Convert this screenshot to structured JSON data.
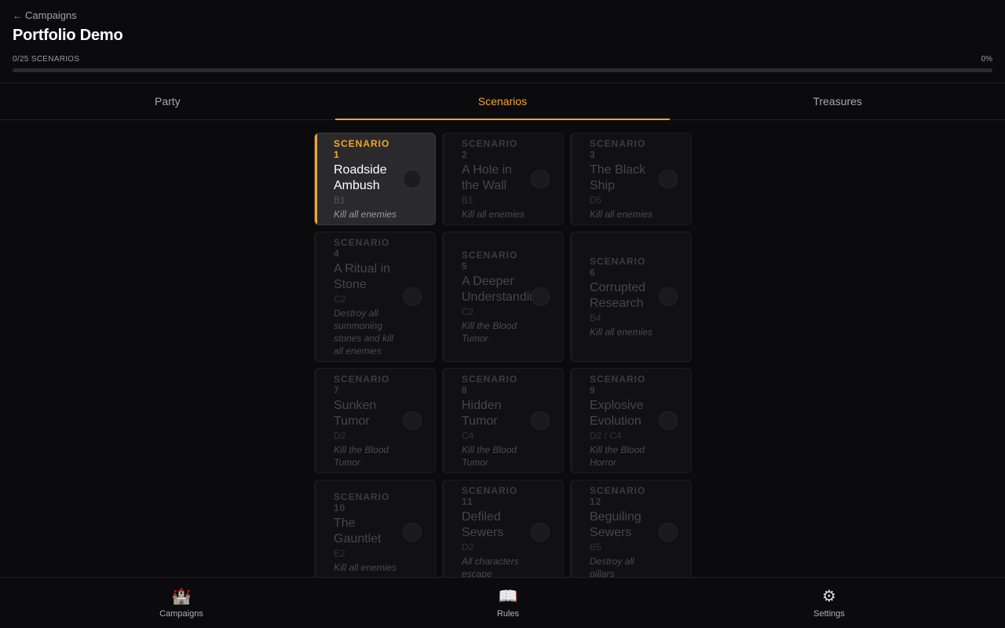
{
  "header": {
    "back_label": "Campaigns",
    "title": "Portfolio Demo",
    "progress_label": "0/25 SCENARIOS",
    "progress_percent_text": "0%",
    "progress_fraction": 0,
    "accent_color": "#f5a623"
  },
  "tabs": [
    {
      "label": "Party",
      "active": false
    },
    {
      "label": "Scenarios",
      "active": true
    },
    {
      "label": "Treasures",
      "active": false
    }
  ],
  "scenarios": [
    {
      "number": "SCENARIO 1",
      "name": "Roadside Ambush",
      "location": "B1",
      "goal": "Kill all enemies",
      "selected": true,
      "completed": false
    },
    {
      "number": "SCENARIO 2",
      "name": "A Hole in the Wall",
      "location": "B1",
      "goal": "Kill all enemies",
      "selected": false,
      "completed": false
    },
    {
      "number": "SCENARIO 3",
      "name": "The Black Ship",
      "location": "D5",
      "goal": "Kill all enemies",
      "selected": false,
      "completed": false
    },
    {
      "number": "SCENARIO 4",
      "name": "A Ritual in Stone",
      "location": "C2",
      "goal": "Destroy all summoning stones and kill all enemies",
      "selected": false,
      "completed": false
    },
    {
      "number": "SCENARIO 5",
      "name": "A Deeper Understanding",
      "location": "C2",
      "goal": "Kill the Blood Tumor",
      "selected": false,
      "completed": false
    },
    {
      "number": "SCENARIO 6",
      "name": "Corrupted Research",
      "location": "B4",
      "goal": "Kill all enemies",
      "selected": false,
      "completed": false
    },
    {
      "number": "SCENARIO 7",
      "name": "Sunken Tumor",
      "location": "D2",
      "goal": "Kill the Blood Tumor",
      "selected": false,
      "completed": false
    },
    {
      "number": "SCENARIO 8",
      "name": "Hidden Tumor",
      "location": "C4",
      "goal": "Kill the Blood Tumor",
      "selected": false,
      "completed": false
    },
    {
      "number": "SCENARIO 9",
      "name": "Explosive Evolution",
      "location": "D2 / C4",
      "goal": "Kill the Blood Horror",
      "selected": false,
      "completed": false
    },
    {
      "number": "SCENARIO 10",
      "name": "The Gauntlet",
      "location": "E2",
      "goal": "Kill all enemies",
      "selected": false,
      "completed": false
    },
    {
      "number": "SCENARIO 11",
      "name": "Defiled Sewers",
      "location": "D2",
      "goal": "All characters escape",
      "selected": false,
      "completed": false
    },
    {
      "number": "SCENARIO 12",
      "name": "Beguiling Sewers",
      "location": "B5",
      "goal": "Destroy all pillars",
      "selected": false,
      "completed": false
    }
  ],
  "bottom_nav": [
    {
      "label": "Campaigns",
      "icon": "castle-icon",
      "glyph": "🏰"
    },
    {
      "label": "Rules",
      "icon": "book-icon",
      "glyph": "📖"
    },
    {
      "label": "Settings",
      "icon": "gear-icon",
      "glyph": "⚙"
    }
  ]
}
